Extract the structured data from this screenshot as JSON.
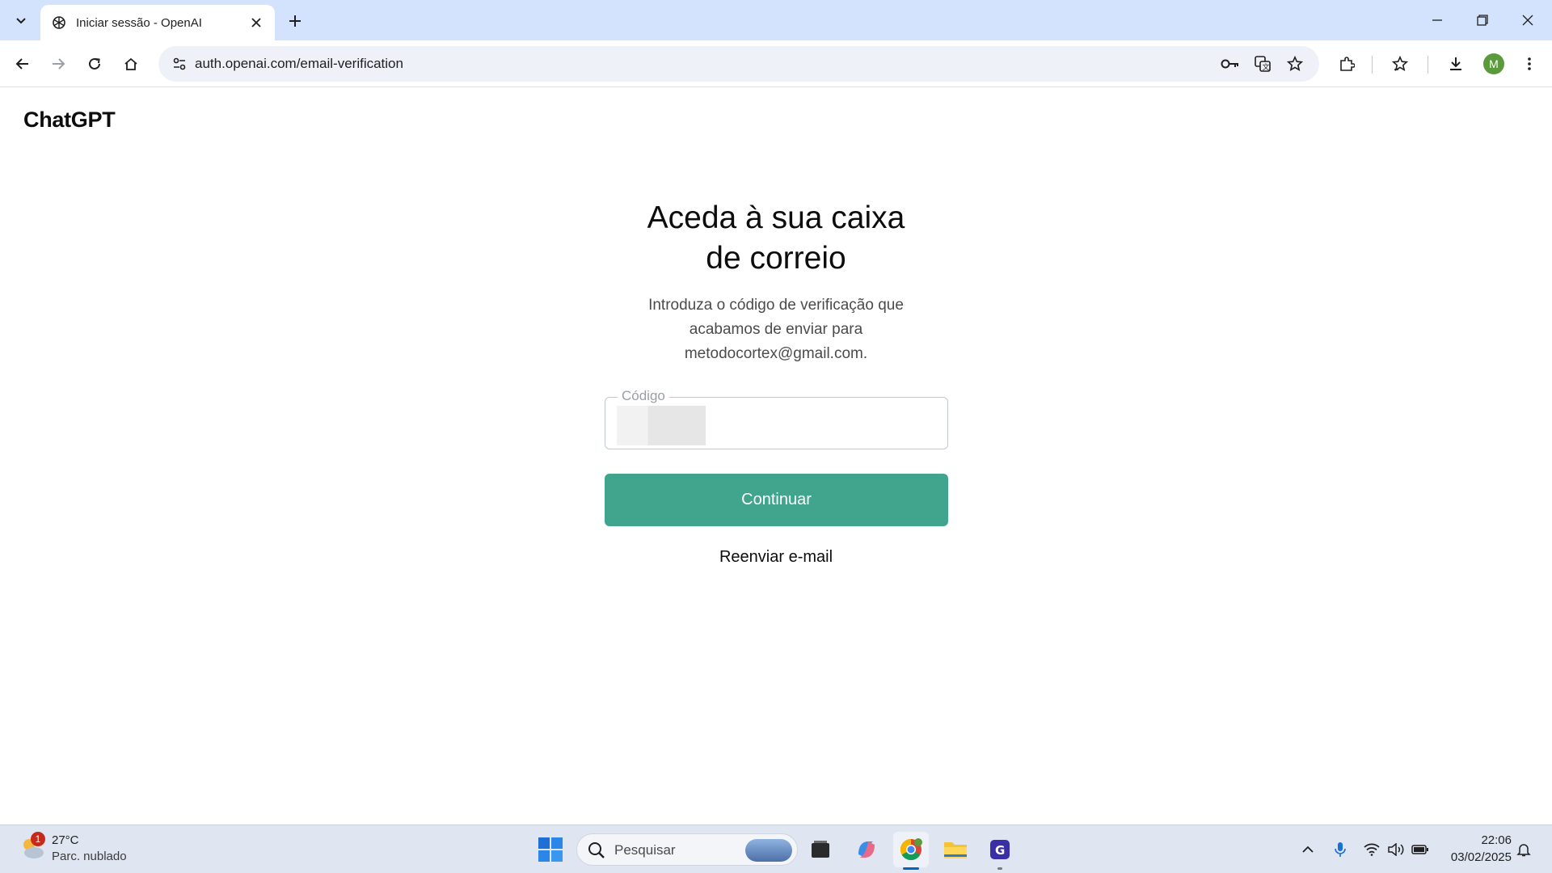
{
  "browser": {
    "tab_title": "Iniciar sessão - OpenAI",
    "url": "auth.openai.com/email-verification",
    "profile_initial": "M"
  },
  "page": {
    "logo": "ChatGPT",
    "heading_line1": "Aceda à sua caixa",
    "heading_line2": "de correio",
    "subtext_line1": "Introduza o código de verificação que",
    "subtext_line2": "acabamos de enviar para",
    "subtext_line3": "metodocortex@gmail.com.",
    "code_label": "Código",
    "continue_label": "Continuar",
    "resend_label": "Reenviar e-mail",
    "accent_color": "#41a58d"
  },
  "taskbar": {
    "weather_temp": "27°C",
    "weather_condition": "Parc. nublado",
    "weather_badge": "1",
    "search_placeholder": "Pesquisar",
    "time": "22:06",
    "date": "03/02/2025"
  },
  "icons": [
    "tab-search-icon",
    "openai-icon",
    "close-icon",
    "plus-icon",
    "minimize-icon",
    "restore-icon",
    "back-icon",
    "forward-icon",
    "reload-icon",
    "home-icon",
    "site-info-icon",
    "key-icon",
    "translate-icon",
    "star-icon",
    "extensions-icon",
    "favorites-icon",
    "download-icon",
    "menu-icon",
    "windows-icon",
    "search-icon",
    "wifi-icon",
    "volume-icon",
    "battery-icon",
    "bell-icon"
  ]
}
